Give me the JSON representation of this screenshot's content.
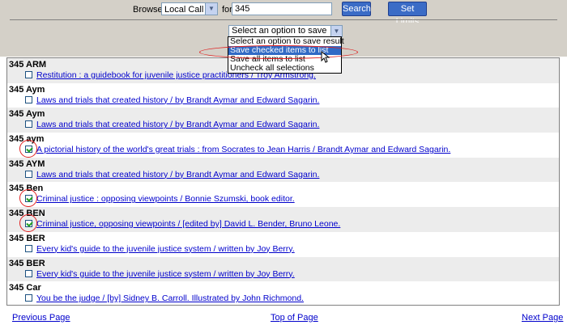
{
  "browse": {
    "label": "Browse:",
    "selected": "Local Call",
    "for_label": "for",
    "query": "345",
    "search_button": "Search",
    "limits_button": "Set Limits"
  },
  "save": {
    "selected": "Select an option to save result",
    "options": [
      "Select an option to save result",
      "Save checked items to list",
      "Save all items to list",
      "Uncheck all selections"
    ],
    "highlighted_index": 1
  },
  "results": [
    {
      "call": "345 ARM",
      "title": "Restitution : a guidebook for juvenile justice practitioners / Troy Armstrong.",
      "checked": false
    },
    {
      "call": "345 Aym",
      "title": "Laws and trials that created history / by Brandt Aymar and Edward Sagarin.",
      "checked": false
    },
    {
      "call": "345 Aym",
      "title": "Laws and trials that created history / by Brandt Aymar and Edward Sagarin.",
      "checked": false
    },
    {
      "call": "345 aym",
      "title": "A pictorial history of the world's great trials : from Socrates to Jean Harris / Brandt Aymar and Edward Sagarin.",
      "checked": true
    },
    {
      "call": "345 AYM",
      "title": "Laws and trials that created history / by Brandt Aymar and Edward Sagarin.",
      "checked": false
    },
    {
      "call": "345 Ben",
      "title": "Criminal justice : opposing viewpoints / Bonnie Szumski, book editor.",
      "checked": true
    },
    {
      "call": "345 BEN",
      "title": "Criminal justice, opposing viewpoints / [edited by] David L. Bender, Bruno Leone.",
      "checked": true
    },
    {
      "call": "345 BER",
      "title": "Every kid's guide to the juvenile justice system / written by Joy Berry.",
      "checked": false
    },
    {
      "call": "345 BER",
      "title": "Every kid's guide to the juvenile justice system / written by Joy Berry.",
      "checked": false
    },
    {
      "call": "345 Car",
      "title": "You be the judge / [by] Sidney B. Carroll. Illustrated by John Richmond.",
      "checked": false
    }
  ],
  "footer": {
    "previous": "Previous Page",
    "top": "Top of Page",
    "next": "Next Page"
  },
  "colors": {
    "button": "#3b6cc6",
    "link": "#0000cc",
    "annotation": "#e02020",
    "highlight": "#316ac5"
  }
}
